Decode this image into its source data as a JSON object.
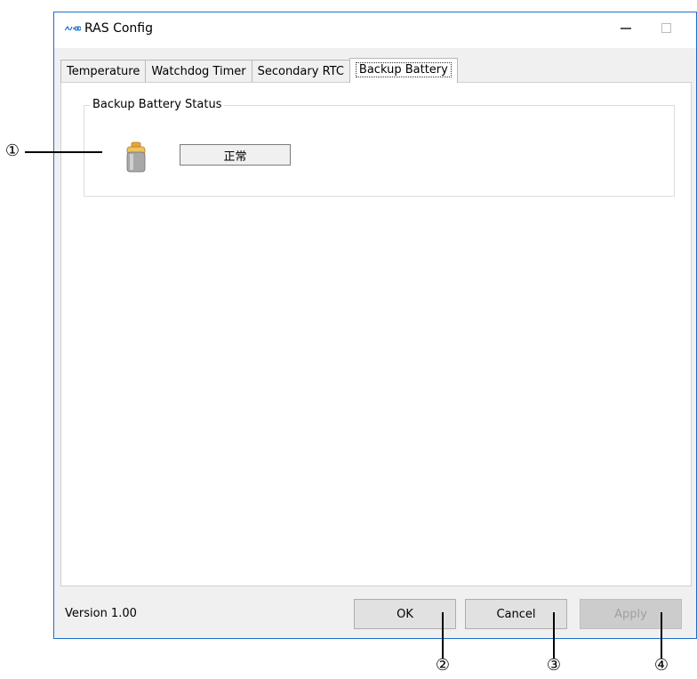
{
  "window": {
    "title": "RAS Config",
    "controls": {
      "minimize": "—",
      "maximize": "☐",
      "close": "✕"
    }
  },
  "tabs": [
    {
      "label": "Temperature",
      "active": false
    },
    {
      "label": "Watchdog Timer",
      "active": false
    },
    {
      "label": "Secondary RTC",
      "active": false
    },
    {
      "label": "Backup Battery",
      "active": true
    }
  ],
  "panel": {
    "group_title": "Backup Battery Status",
    "status_value": "正常",
    "icon": "battery-icon"
  },
  "footer": {
    "version": "Version 1.00",
    "ok_label": "OK",
    "cancel_label": "Cancel",
    "apply_label": "Apply"
  },
  "callouts": [
    "①",
    "②",
    "③",
    "④"
  ],
  "colors": {
    "window_border": "#1e6fc8",
    "battery_body": "#a8a8a8",
    "battery_cap": "#e8a63a"
  }
}
